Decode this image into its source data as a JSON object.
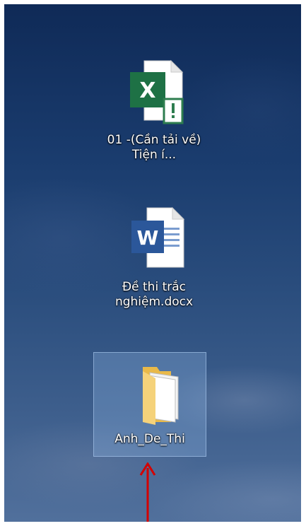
{
  "desktop": {
    "icons": [
      {
        "label": "01 -(Cần tải về) Tiện í...",
        "icon": "excel-file-with-warning-icon",
        "selected": false
      },
      {
        "label": "Đề thi trắc nghiệm.docx",
        "icon": "word-document-icon",
        "selected": false
      },
      {
        "label": "Anh_De_Thi",
        "icon": "folder-icon",
        "selected": true
      }
    ]
  },
  "annotation": {
    "arrow_color": "#d40000",
    "arrow_direction": "up"
  },
  "colors": {
    "excel_green": "#1e7145",
    "word_blue": "#2b579a",
    "folder_yellow": "#f5d27a",
    "selection_highlight": "#96beeb"
  }
}
